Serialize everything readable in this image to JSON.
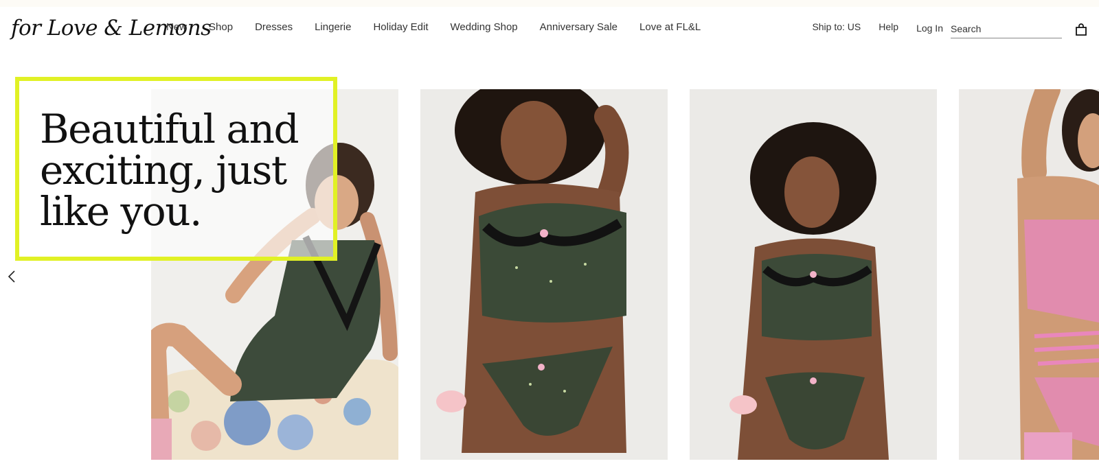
{
  "brand": {
    "logo_text": "for Love & Lemons"
  },
  "nav": {
    "items": [
      {
        "label": "New"
      },
      {
        "label": "Shop"
      },
      {
        "label": "Dresses"
      },
      {
        "label": "Lingerie"
      },
      {
        "label": "Holiday Edit"
      },
      {
        "label": "Wedding Shop"
      },
      {
        "label": "Anniversary Sale"
      },
      {
        "label": "Love at FL&L"
      }
    ]
  },
  "utility": {
    "ship_to": "Ship to: US",
    "help": "Help",
    "login": "Log In",
    "search_placeholder": "Search",
    "bag_icon": "shopping-bag-icon"
  },
  "hero": {
    "headline": "Beautiful and exciting, just like you.",
    "prev_icon": "chevron-left-icon",
    "highlight_color": "#e1f125",
    "slides": [
      {
        "description_icon": "model-photo-slip-dress"
      },
      {
        "description_icon": "model-photo-floral-set"
      },
      {
        "description_icon": "model-photo-floral-set-2"
      },
      {
        "description_icon": "model-photo-pink-lace"
      }
    ]
  }
}
